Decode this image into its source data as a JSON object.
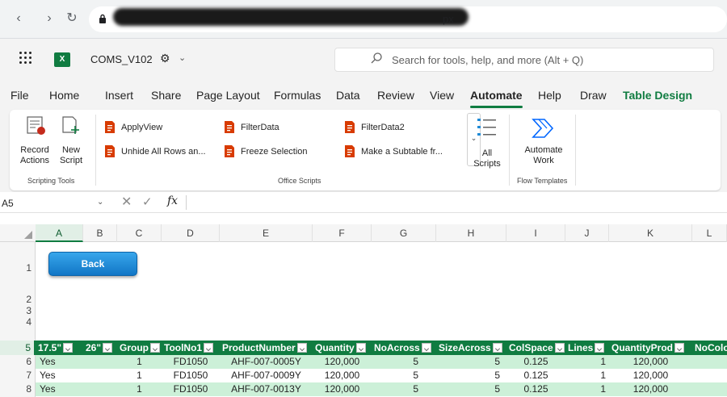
{
  "browser": {
    "back_glyph": "‹",
    "forward_glyph": "›",
    "reload_glyph": "↻",
    "url_tail": "px"
  },
  "app": {
    "doc_title": "COMS_V102",
    "search_placeholder": "Search for tools, help, and more (Alt + Q)"
  },
  "tabs": [
    "File",
    "Home",
    "Insert",
    "Share",
    "Page Layout",
    "Formulas",
    "Data",
    "Review",
    "View",
    "Automate",
    "Help",
    "Draw",
    "Table Design"
  ],
  "active_tab": "Automate",
  "ribbon": {
    "record_actions": "Record Actions",
    "new_script": "New Script",
    "group_scripting": "Scripting Tools",
    "scripts": [
      "ApplyView",
      "FilterData",
      "FilterData2",
      "Unhide All Rows an...",
      "Freeze Selection",
      "Make a Subtable fr..."
    ],
    "group_office": "Office Scripts",
    "all_scripts": "All Scripts",
    "automate_work": "Automate Work",
    "group_flow": "Flow Templates"
  },
  "formula_bar": {
    "name_box": "A5",
    "fx_label": "fx"
  },
  "grid": {
    "columns": [
      "A",
      "B",
      "C",
      "D",
      "E",
      "F",
      "G",
      "H",
      "I",
      "J",
      "K",
      "L"
    ],
    "selected_column": "A",
    "row_numbers": [
      "1",
      "2",
      "3",
      "4",
      "5",
      "6",
      "7",
      "8"
    ],
    "selected_row": "5",
    "back_button": "Back",
    "table_headers": [
      "17.5\"",
      "26\"",
      "Group",
      "ToolNo1",
      "ProductNumber",
      "Quantity",
      "NoAcross",
      "SizeAcross",
      "ColSpace",
      "Lines",
      "QuantityProd",
      "NoColo"
    ],
    "rows": [
      [
        "Yes",
        "",
        "1",
        "FD1050",
        "AHF-007-0005Y",
        "120,000",
        "5",
        "5",
        "0.125",
        "1",
        "120,000"
      ],
      [
        "Yes",
        "",
        "1",
        "FD1050",
        "AHF-007-0009Y",
        "120,000",
        "5",
        "5",
        "0.125",
        "1",
        "120,000"
      ],
      [
        "Yes",
        "",
        "1",
        "FD1050",
        "AHF-007-0013Y",
        "120,000",
        "5",
        "5",
        "0.125",
        "1",
        "120,000"
      ]
    ]
  },
  "colors": {
    "excel_green": "#107c41",
    "band_green": "#ccf0d8",
    "back_button_blue": "#1f8ad6"
  }
}
